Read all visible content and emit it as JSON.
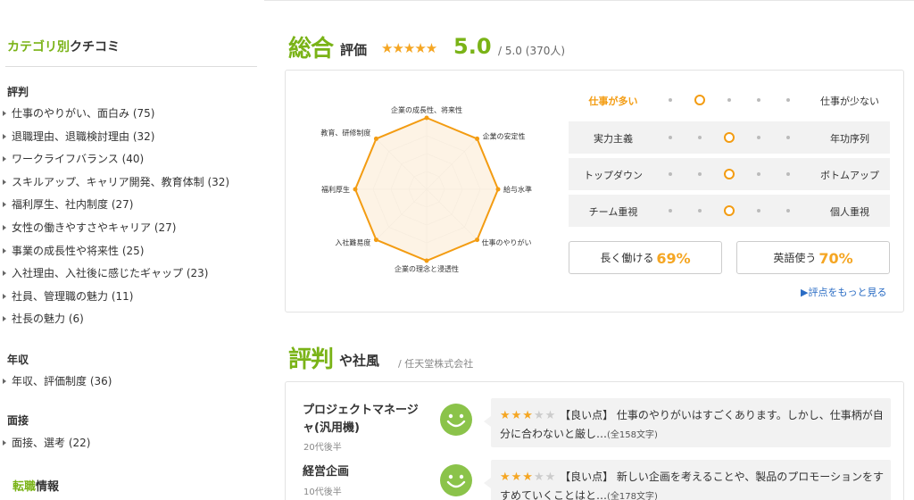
{
  "sidebar": {
    "title_green": "カテゴリ別",
    "title_rest": "クチコミ",
    "sections": [
      {
        "heading": "評判",
        "items": [
          "仕事のやりがい、面白み (75)",
          "退職理由、退職検討理由 (32)",
          "ワークライフバランス (40)",
          "スキルアップ、キャリア開発、教育体制 (32)",
          "福利厚生、社内制度 (27)",
          "女性の働きやすさやキャリア (27)",
          "事業の成長性や将来性 (25)",
          "入社理由、入社後に感じたギャップ (23)",
          "社員、管理職の魅力 (11)",
          "社長の魅力 (6)"
        ]
      },
      {
        "heading": "年収",
        "items": [
          "年収、評価制度 (36)"
        ]
      },
      {
        "heading": "面接",
        "items": [
          "面接、選考 (22)"
        ]
      }
    ],
    "tenshoku_green": "転職",
    "tenshoku_rest": "情報"
  },
  "overall": {
    "title_big": "総合",
    "title_small": "評価",
    "stars": "★★★★★",
    "score": "5.0",
    "out_of": "/ 5.0 (370人)"
  },
  "radar": {
    "labels": [
      "企業の成長性、将来性",
      "企業の安定性",
      "給与水準",
      "仕事のやりがい",
      "企業の理念と浸透性",
      "入社難易度",
      "福利厚生",
      "教育、研修制度"
    ],
    "values": [
      1.0,
      1.0,
      1.0,
      1.0,
      1.0,
      1.0,
      1.0,
      1.0
    ],
    "max": 1.0,
    "colors": {
      "stroke": "#f39c12",
      "fill": "#fdf1e0",
      "grid": "#cccccc"
    }
  },
  "scales": [
    {
      "left": "仕事が多い",
      "right": "仕事が少ない",
      "position": 2,
      "highlight_left": true
    },
    {
      "left": "実力主義",
      "right": "年功序列",
      "position": 3,
      "highlight_left": false
    },
    {
      "left": "トップダウン",
      "right": "ボトムアップ",
      "position": 3,
      "highlight_left": false
    },
    {
      "left": "チーム重視",
      "right": "個人重視",
      "position": 3,
      "highlight_left": false
    }
  ],
  "percents": [
    {
      "label": "長く働ける",
      "value": "69%"
    },
    {
      "label": "英語使う",
      "value": "70%"
    }
  ],
  "more_link": "▶評点をもっと見る",
  "reviews_header": {
    "title_big": "評判",
    "title_small": "や社風",
    "company": "/ 任天堂株式会社"
  },
  "reviews": [
    {
      "title_line1": "プロジェクトマネージ",
      "title_line2": "ャ(汎用機)",
      "age": "20代後半",
      "stars_on": "★★★",
      "stars_off": "★★",
      "text": "【良い点】 仕事のやりがいはすごくあります。しかし、仕事柄が自分に合わないと厳し…",
      "count": "(全158文字)"
    },
    {
      "title_line1": "経営企画",
      "title_line2": "",
      "age": "10代後半",
      "stars_on": "★★★",
      "stars_off": "★★",
      "text": "【良い点】 新しい企画を考えることや、製品のプロモーションをすすめていくことはと…",
      "count": "(全178文字)"
    }
  ]
}
